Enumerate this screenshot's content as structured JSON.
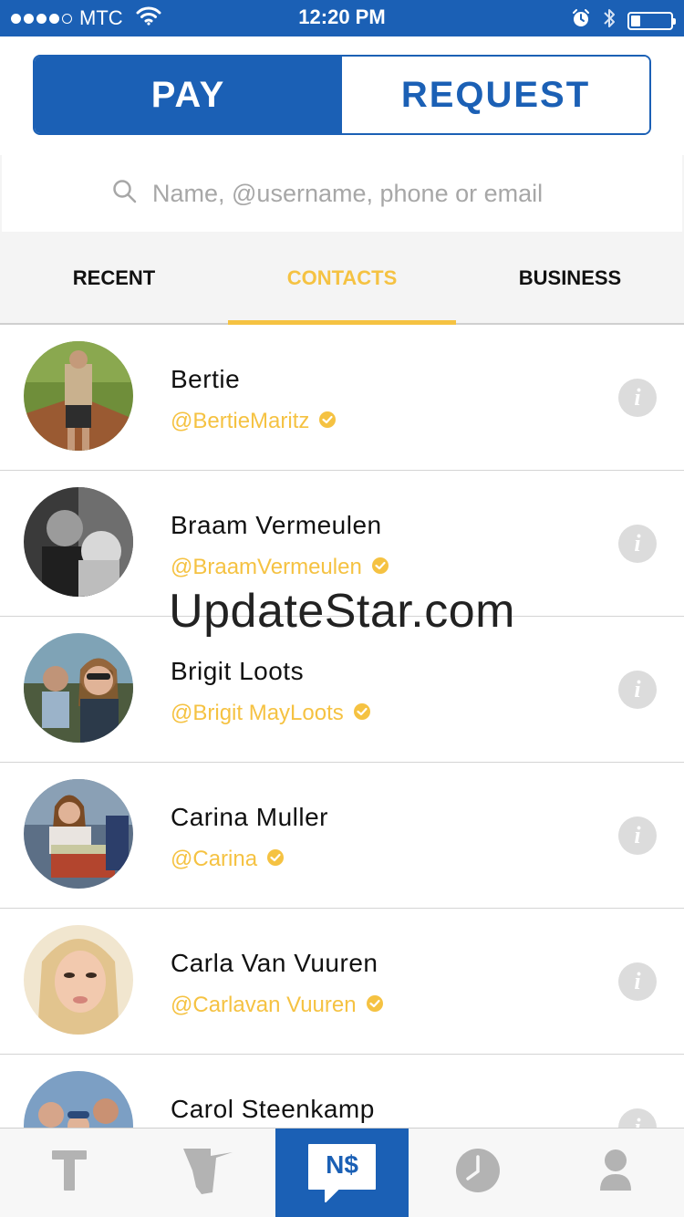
{
  "status_bar": {
    "carrier": "MTC",
    "time": "12:20 PM",
    "signal_bars_filled": 4,
    "battery_level": 0.2
  },
  "segmented": {
    "pay_label": "PAY",
    "request_label": "REQUEST",
    "selected": "PAY"
  },
  "search": {
    "placeholder": "Name, @username, phone or email",
    "value": ""
  },
  "tabs": {
    "recent": "RECENT",
    "contacts": "CONTACTS",
    "business": "BUSINESS",
    "active": "CONTACTS"
  },
  "contacts": [
    {
      "name": "Bertie",
      "handle": "@BertieMaritz",
      "verified": true
    },
    {
      "name": "Braam Vermeulen",
      "handle": "@BraamVermeulen",
      "verified": true
    },
    {
      "name": "Brigit Loots",
      "handle": "@Brigit MayLoots",
      "verified": true
    },
    {
      "name": "Carina Muller",
      "handle": "@Carina",
      "verified": true
    },
    {
      "name": "Carla Van Vuuren",
      "handle": "@Carlavan Vuuren",
      "verified": true
    },
    {
      "name": "Carol Steenkamp",
      "handle": "",
      "verified": false
    }
  ],
  "watermark": "UpdateStar.com",
  "bottom_nav": {
    "active_label": "N$",
    "icons": [
      "t-logo-icon",
      "namibia-map-icon",
      "money-chat-icon",
      "clock-icon",
      "profile-icon"
    ]
  },
  "colors": {
    "primary_blue": "#1b60b5",
    "accent_yellow": "#f5c242",
    "info_gray": "#dcdcdc"
  }
}
